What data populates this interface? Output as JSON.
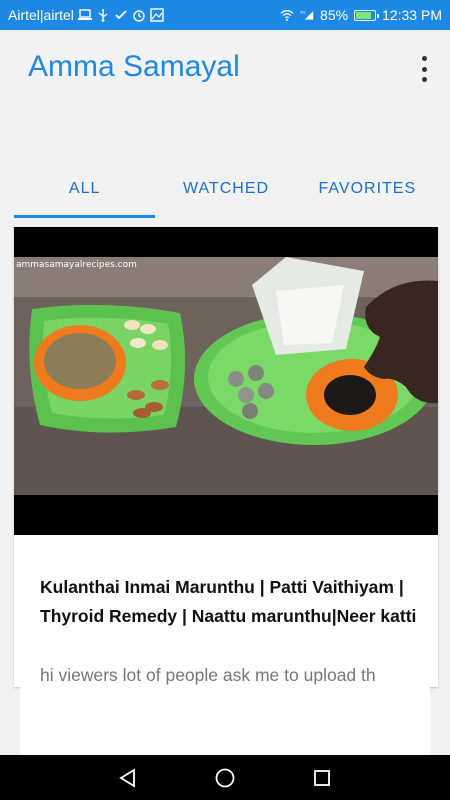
{
  "status_bar": {
    "carrier": "Airtel|airtel",
    "network": "4G",
    "battery": "85%",
    "battery_level": 0.85,
    "time": "12:33 PM"
  },
  "app": {
    "title": "Amma Samayal"
  },
  "tabs": [
    {
      "label": "ALL",
      "active": true
    },
    {
      "label": "WATCHED",
      "active": false
    },
    {
      "label": "FAVORITES",
      "active": false
    }
  ],
  "video": {
    "watermark": "ammasamayalrecipes.com",
    "title": "Kulanthai Inmai Marunthu | Patti Vaithiyam | Thyroid Remedy | Naattu marunthu|Neer katti",
    "description": "hi viewers lot of people ask me to upload th"
  },
  "colors": {
    "accent": "#1e88e5",
    "tab_text": "#1e6fc8",
    "background": "#f2f2f2"
  }
}
